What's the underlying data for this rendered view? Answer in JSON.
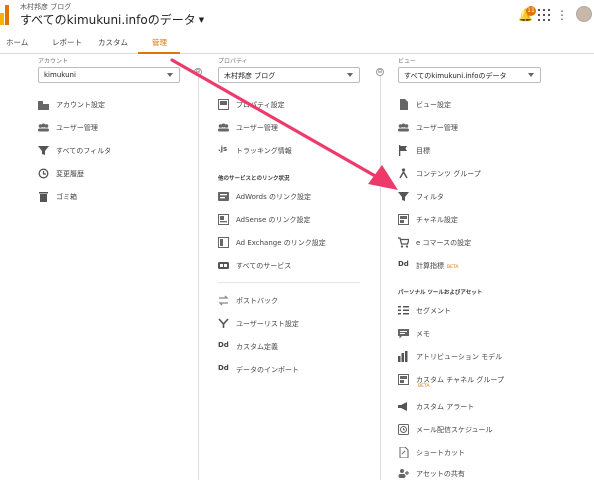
{
  "header": {
    "site_name": "木村邦彦 ブログ",
    "title": "すべてのkimukuni.infoのデータ",
    "notification_count": "11"
  },
  "tabs": [
    {
      "label": "ホーム"
    },
    {
      "label": "レポート"
    },
    {
      "label": "カスタム"
    },
    {
      "label": "管理"
    }
  ],
  "account": {
    "label": "アカウント",
    "selected": "kimukuni",
    "items": [
      {
        "label": "アカウント設定",
        "icon": "building-icon"
      },
      {
        "label": "ユーザー管理",
        "icon": "users-icon"
      },
      {
        "label": "すべてのフィルタ",
        "icon": "filter-icon"
      },
      {
        "label": "変更履歴",
        "icon": "history-icon"
      },
      {
        "label": "ゴミ箱",
        "icon": "trash-icon"
      }
    ]
  },
  "property": {
    "label": "プロパティ",
    "selected": "木村邦彦 ブログ",
    "items": [
      {
        "label": "プロパティ設定",
        "icon": "property-icon"
      },
      {
        "label": "ユーザー管理",
        "icon": "users-icon"
      },
      {
        "label": "トラッキング情報",
        "icon": "js-icon"
      }
    ],
    "section_title": "他のサービスとのリンク状況",
    "link_items": [
      {
        "label": "AdWords のリンク設定",
        "icon": "adwords-icon"
      },
      {
        "label": "AdSense のリンク設定",
        "icon": "adsense-icon"
      },
      {
        "label": "Ad Exchange のリンク設定",
        "icon": "adexchange-icon"
      },
      {
        "label": "すべてのサービス",
        "icon": "all-services-icon"
      }
    ],
    "other_items": [
      {
        "label": "ポストバック",
        "icon": "postback-icon"
      },
      {
        "label": "ユーザーリスト設定",
        "icon": "audience-icon"
      },
      {
        "label": "カスタム定義",
        "icon": "dd-icon"
      },
      {
        "label": "データのインポート",
        "icon": "dd-icon"
      }
    ]
  },
  "view": {
    "label": "ビュー",
    "selected": "すべてのkimukuni.infoのデータ",
    "items": [
      {
        "label": "ビュー設定",
        "icon": "doc-icon"
      },
      {
        "label": "ユーザー管理",
        "icon": "users-icon"
      },
      {
        "label": "目標",
        "icon": "flag-icon"
      },
      {
        "label": "コンテンツ グループ",
        "icon": "content-group-icon"
      },
      {
        "label": "フィルタ",
        "icon": "filter-icon"
      },
      {
        "label": "チャネル設定",
        "icon": "channel-icon"
      },
      {
        "label": "e コマースの設定",
        "icon": "cart-icon"
      },
      {
        "label": "計算指標",
        "icon": "dd-icon",
        "badge": "BETA"
      }
    ],
    "section_title": "パーソナル ツールおよびアセット",
    "tool_items": [
      {
        "label": "セグメント",
        "icon": "segment-icon"
      },
      {
        "label": "メモ",
        "icon": "memo-icon"
      },
      {
        "label": "アトリビューション モデル",
        "icon": "bar-chart-icon"
      },
      {
        "label": "カスタム チャネル グループ",
        "icon": "channel-icon",
        "badge": "BETA"
      },
      {
        "label": "カスタム アラート",
        "icon": "megaphone-icon"
      },
      {
        "label": "メール配信スケジュール",
        "icon": "clock-icon"
      },
      {
        "label": "ショートカット",
        "icon": "shortcut-icon"
      },
      {
        "label": "アセットの共有",
        "icon": "share-icon"
      }
    ]
  },
  "colors": {
    "accent": "#e37400",
    "annotation_arrow": "#ee3a6a"
  }
}
